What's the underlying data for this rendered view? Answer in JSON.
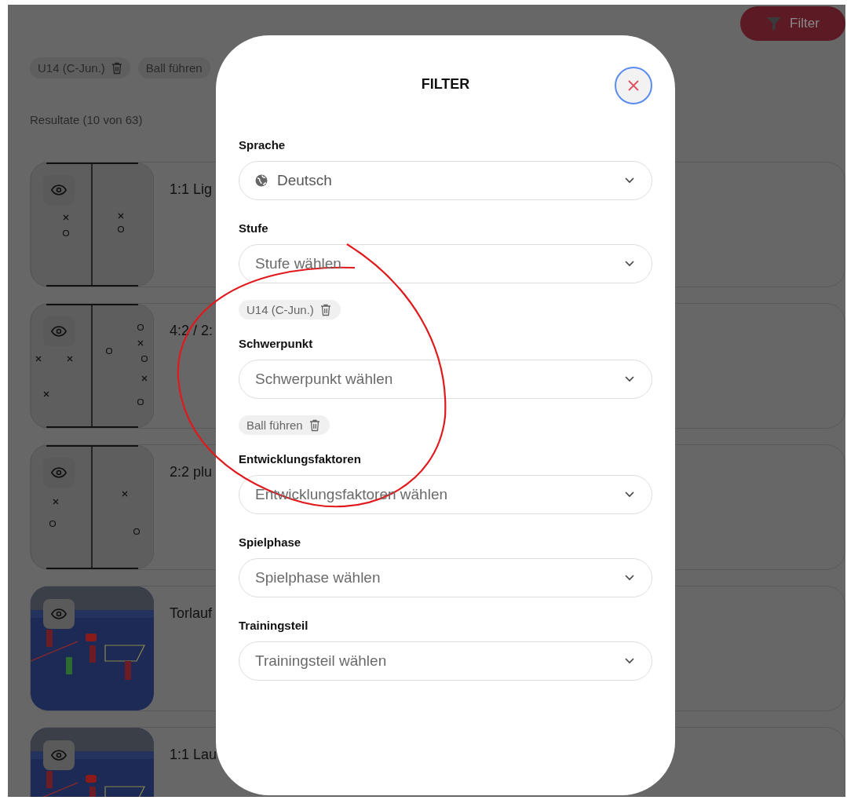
{
  "background": {
    "filter_button": "Filter",
    "active_chips": [
      {
        "label": "U14 (C-Jun.)",
        "delete_icon": true
      },
      {
        "label": "Ball führen",
        "delete_icon": false
      }
    ],
    "results_label": "Resultate (10 von 63)",
    "results": [
      {
        "title": "1:1 Lig",
        "kind": "diagram"
      },
      {
        "title": "4:2 / 2:",
        "kind": "diagram"
      },
      {
        "title": "2:2 plu",
        "kind": "diagram"
      },
      {
        "title": "Torlauf",
        "kind": "picture"
      },
      {
        "title": "1:1 Lau",
        "kind": "picture"
      }
    ]
  },
  "filter_dialog": {
    "title": "FILTER",
    "fields": [
      {
        "label": "Sprache",
        "value": "Deutsch"
      },
      {
        "label": "Stufe",
        "placeholder": "Stufe wählen",
        "chips": [
          "U14 (C-Jun.)"
        ]
      },
      {
        "label": "Schwerpunkt",
        "placeholder": "Schwerpunkt wählen",
        "chips": [
          "Ball führen"
        ]
      },
      {
        "label": "Entwicklungsfaktoren",
        "placeholder": "Entwicklungsfaktoren wählen"
      },
      {
        "label": "Spielphase",
        "placeholder": "Spielphase wählen"
      },
      {
        "label": "Trainingsteil",
        "placeholder": "Trainingsteil wählen"
      }
    ]
  }
}
